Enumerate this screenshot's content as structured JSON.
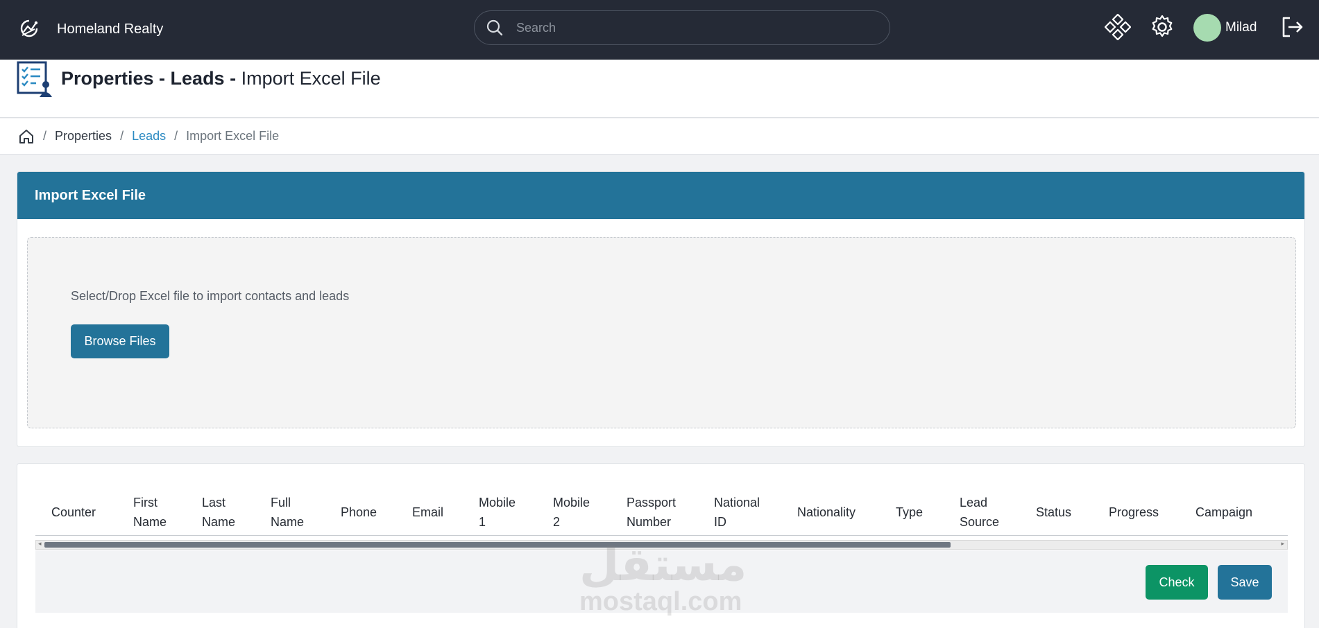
{
  "header": {
    "brand_name": "Homeland Realty",
    "search_placeholder": "Search",
    "user_name": "Milad",
    "icons": [
      "brand-logo-icon",
      "search-icon",
      "apps-diamond-icon",
      "gear-icon",
      "avatar",
      "logout-icon"
    ]
  },
  "page": {
    "title_bold": "Properties - Leads -",
    "title_rest": "Import Excel File"
  },
  "breadcrumb": {
    "items": [
      "Properties",
      "Leads",
      "Import Excel File"
    ],
    "separator": "/"
  },
  "import_card": {
    "title": "Import Excel File",
    "drop_text": "Select/Drop Excel file to import contacts and leads",
    "browse_label": "Browse Files"
  },
  "table": {
    "columns": [
      [
        "Counter"
      ],
      [
        "First",
        "Name"
      ],
      [
        "Last",
        "Name"
      ],
      [
        "Full",
        "Name"
      ],
      [
        "Phone"
      ],
      [
        "Email"
      ],
      [
        "Mobile",
        "1"
      ],
      [
        "Mobile",
        "2"
      ],
      [
        "Passport",
        "Number"
      ],
      [
        "National",
        "ID"
      ],
      [
        "Nationality"
      ],
      [
        "Type"
      ],
      [
        "Lead",
        "Source"
      ],
      [
        "Status"
      ],
      [
        "Progress"
      ],
      [
        "Campaign"
      ]
    ],
    "check_label": "Check",
    "save_label": "Save"
  },
  "watermark": {
    "arabic": "مستقل",
    "latin": "mostaql.com"
  },
  "colors": {
    "topbar": "#252a36",
    "primary": "#237399",
    "success": "#0c9465",
    "link": "#2b8ac2",
    "avatar": "#a6dbb0"
  }
}
